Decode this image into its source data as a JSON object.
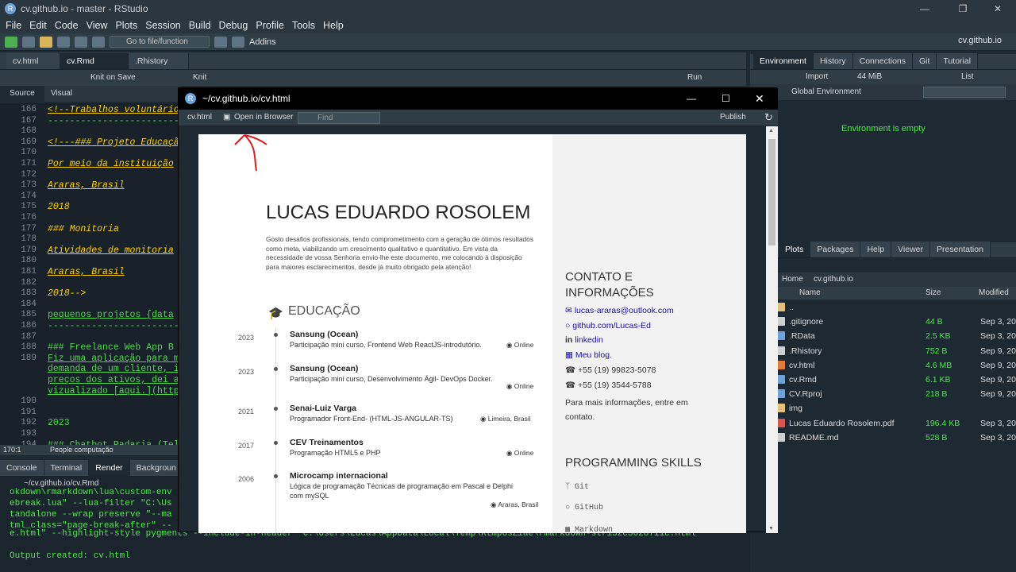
{
  "window": {
    "title": "cv.github.io - master - RStudio",
    "app_icon": "R"
  },
  "menu": [
    "File",
    "Edit",
    "Code",
    "View",
    "Plots",
    "Session",
    "Build",
    "Debug",
    "Profile",
    "Tools",
    "Help"
  ],
  "toolbar": {
    "goto_placeholder": "Go to file/function",
    "addins": "Addins",
    "project": "cv.github.io"
  },
  "source": {
    "tabs": [
      "cv.html",
      "cv.Rmd",
      ".Rhistory"
    ],
    "knit_on_save": "Knit on Save",
    "knit": "Knit",
    "run": "Run",
    "subtabs": [
      "Source",
      "Visual"
    ],
    "lines": [
      {
        "n": "166",
        "t": "<!--Trabalhos voluntário",
        "cls": "i u"
      },
      {
        "n": "167",
        "t": "---------------------------",
        "cls": ""
      },
      {
        "n": "168",
        "t": "",
        "cls": ""
      },
      {
        "n": "169",
        "t": "<!---### Projeto Educaçã",
        "cls": "i u"
      },
      {
        "n": "170",
        "t": "",
        "cls": ""
      },
      {
        "n": "171",
        "t": "Por meio da instituição",
        "cls": "i u"
      },
      {
        "n": "172",
        "t": "",
        "cls": ""
      },
      {
        "n": "173",
        "t": "Araras, Brasil",
        "cls": "i u"
      },
      {
        "n": "174",
        "t": "",
        "cls": ""
      },
      {
        "n": "175",
        "t": "2018",
        "cls": "i"
      },
      {
        "n": "176",
        "t": "",
        "cls": ""
      },
      {
        "n": "177",
        "t": "### Monitoria",
        "cls": "i"
      },
      {
        "n": "178",
        "t": "",
        "cls": ""
      },
      {
        "n": "179",
        "t": "Atividades de monitoria",
        "cls": "i u"
      },
      {
        "n": "180",
        "t": "",
        "cls": ""
      },
      {
        "n": "181",
        "t": "Araras, Brasil",
        "cls": "i u"
      },
      {
        "n": "182",
        "t": "",
        "cls": ""
      },
      {
        "n": "183",
        "t": "2018-->",
        "cls": "i"
      },
      {
        "n": "184",
        "t": "",
        "cls": ""
      },
      {
        "n": "185",
        "t": "pequenos projetos  {data",
        "cls": "u"
      },
      {
        "n": "186",
        "t": "---------------------------",
        "cls": ""
      },
      {
        "n": "187",
        "t": "",
        "cls": ""
      },
      {
        "n": "188",
        "t": "### Freelance Web App B",
        "cls": ""
      },
      {
        "n": "189",
        "t": "Fiz uma aplicação para m",
        "cls": "u"
      },
      {
        "n": "",
        "t": "demanda de um cliente, i",
        "cls": "u"
      },
      {
        "n": "",
        "t": "preços dos ativos, dei a",
        "cls": "u"
      },
      {
        "n": "",
        "t": "vizualizado [aqui.](http",
        "cls": "u"
      },
      {
        "n": "190",
        "t": "",
        "cls": ""
      },
      {
        "n": "191",
        "t": "",
        "cls": ""
      },
      {
        "n": "192",
        "t": "2023",
        "cls": ""
      },
      {
        "n": "193",
        "t": "",
        "cls": ""
      },
      {
        "n": "194",
        "t": "### Chatbot Padaria (Tel",
        "cls": ""
      }
    ],
    "status_pos": "170:1",
    "status_section": "People computação"
  },
  "console": {
    "tabs": [
      "Console",
      "Terminal",
      "Render",
      "Backgroun"
    ],
    "path": "~/cv.github.io/cv.Rmd",
    "lines": [
      "okdown\\rmarkdown\\lua\\custom-env",
      "ebreak.lua\" --lua-filter \"C:\\Us",
      "tandalone --wrap preserve \"--ma",
      "tml_class=\"page-break-after\" --",
      "e.html\" --highlight-style pygments --include-in-header \"C:\\Users\\Lucas\\AppData\\Local\\Temp\\RtmpGsZiae\\rmarkdown-str152c3628711c.html",
      "",
      "Output created: cv.html"
    ]
  },
  "env": {
    "tabs": [
      "Environment",
      "History",
      "Connections",
      "Git",
      "Tutorial"
    ],
    "import": "Import",
    "mem": "44 MiB",
    "list": "List",
    "global": "Global Environment",
    "empty": "Environment is empty"
  },
  "files": {
    "tabs": [
      "Plots",
      "Packages",
      "Help",
      "Viewer",
      "Presentation"
    ],
    "breadcrumb_home": "Home",
    "breadcrumb_dir": "cv.github.io",
    "cols": [
      "Name",
      "Size",
      "Modified"
    ],
    "rows": [
      {
        "name": "..",
        "size": "",
        "mod": "",
        "color": "#e5c07b"
      },
      {
        "name": ".gitignore",
        "size": "44 B",
        "mod": "Sep 3, 20",
        "color": "#cfcfcf"
      },
      {
        "name": ".RData",
        "size": "2.5 KB",
        "mod": "Sep 3, 20",
        "color": "#6fa3d8"
      },
      {
        "name": ".Rhistory",
        "size": "752 B",
        "mod": "Sep 9, 20",
        "color": "#cfcfcf"
      },
      {
        "name": "cv.html",
        "size": "4.6 MB",
        "mod": "Sep 9, 20",
        "color": "#e07b39"
      },
      {
        "name": "cv.Rmd",
        "size": "6.1 KB",
        "mod": "Sep 9, 20",
        "color": "#6fa3d8"
      },
      {
        "name": "CV.Rproj",
        "size": "218 B",
        "mod": "Sep 9, 20",
        "color": "#6fa3d8"
      },
      {
        "name": "img",
        "size": "",
        "mod": "",
        "color": "#e5c07b"
      },
      {
        "name": "Lucas Eduardo Rosolem.pdf",
        "size": "196.4 KB",
        "mod": "Sep 3, 20",
        "color": "#d9534f"
      },
      {
        "name": "README.md",
        "size": "528 B",
        "mod": "Sep 3, 20",
        "color": "#cfcfcf"
      }
    ]
  },
  "viewer": {
    "title": "~/cv.github.io/cv.html",
    "file": "cv.html",
    "open": "Open in Browser",
    "find": "Find",
    "publish": "Publish",
    "name": "LUCAS EDUARDO ROSOLEM",
    "intro": "Gosto desafios profissionais, tendo comprometimento com a geração de ótimos resultados como meta, viabilizando um crescimento qualitativo e quantitativo. Em vista da necessidade de vossa Senhoria envio-lhe este documento, me colocando à disposição para maiores esclarecimentos, desde já muito obrigado pela atenção!",
    "edu_title": "EDUCAÇÃO",
    "entries": [
      {
        "year": "2023",
        "title": "Sansung (Ocean)",
        "desc": "Participação mini curso, Frontend Web ReactJS-introdutório.",
        "loc": "Online"
      },
      {
        "year": "2023",
        "title": "Sansung (Ocean)",
        "desc": "Participação mini curso, Desenvolvimento Ágil- DevOps Docker.",
        "loc": "Online"
      },
      {
        "year": "2021",
        "title": "Senai-Luiz Varga",
        "desc": "Programador Front-End- (HTML-JS-ANGULAR-TS)",
        "loc": "Limeira, Brasil"
      },
      {
        "year": "2017",
        "title": "CEV Treinamentos",
        "desc": "Programação HTML5 e PHP",
        "loc": "Online"
      },
      {
        "year": "2006",
        "title": "Microcamp internacional",
        "desc": "Lógica de programação Técnicas de programação em Pascal e Delphi com mySQL",
        "loc": "Araras, Brasil"
      }
    ],
    "contact_title": "CONTATO E INFORMAÇÕES",
    "email": "lucas-araras@outlook.com",
    "github": "github.com/Lucas-Ed",
    "linkedin": "linkedin",
    "blog": "Meu blog.",
    "phone1": "+55 (19) 99823-5078",
    "phone2": "+55 (19) 3544-5788",
    "more": "Para mais informações, entre em contato.",
    "skills_title": "PROGRAMMING SKILLS",
    "skills": [
      "Git",
      "GitHub",
      "Markdown"
    ]
  }
}
